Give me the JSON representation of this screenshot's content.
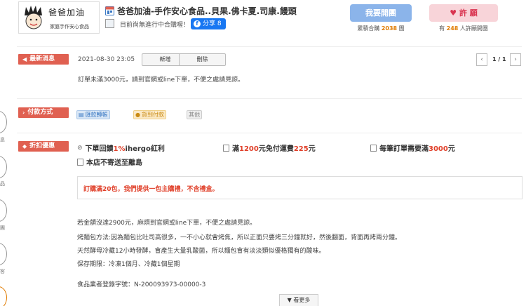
{
  "header": {
    "logo": {
      "title": "爸爸加油",
      "subtitle": "家庭手作安心食品"
    },
    "store_title": "爸爸加油-手作安心食品..貝果.佛卡夏.司康.饅頭",
    "store_status": "目前尚無進行中合購喔！",
    "share": {
      "label": "分享 8",
      "icon": "facebook-icon"
    },
    "open_group_button": "我要開團",
    "open_group_stat": {
      "prefix": "累積合購",
      "count": "2038",
      "suffix": "團"
    },
    "wish_button": "許 願",
    "wish_stat": {
      "prefix": "有",
      "count": "248",
      "suffix": "人許願開團"
    }
  },
  "sidenav": {
    "labels": [
      "息",
      "品",
      "團",
      "客"
    ]
  },
  "news": {
    "tag": "最新消息",
    "date": "2021-08-30 23:05",
    "add_button": "新增",
    "delete_button": "刪除",
    "pager": "1 / 1",
    "prev_icon": "chevron-left-icon",
    "next_icon": "chevron-right-icon",
    "text": "訂單未滿3000元，請到官網或line下單，不便之處請見諒。"
  },
  "payment": {
    "tag": "付款方式",
    "methods": [
      "匯款轉帳",
      "貨到付款",
      "其他"
    ]
  },
  "discount": {
    "tag": "折扣優惠",
    "items": [
      {
        "pre": "下單回饋",
        "hl": "1%",
        "post": "ihergo紅利"
      },
      {
        "pre": "滿",
        "hl": "1200",
        "mid": "元免付運費",
        "hl2": "225",
        "post": "元"
      },
      {
        "pre": "每筆訂單需要滿",
        "hl": "3000",
        "post": "元"
      }
    ],
    "no_island": "本店不寄送至離島",
    "notice": "訂購滿20包，我們提供一包主購禮，不含禮盒。"
  },
  "description": {
    "lines": [
      "若金額沒達2900元，麻煩到官網或line下單，不便之處請見諒。",
      "烤麵包方法:因為麵包比吐司高很多，一不小心就會烤焦，所以正面只要烤三分鐘就好，然後翻面，背面再烤兩分鐘。",
      "天然酵母冷藏12小時發酵，會產生大量乳酸菌，所以麵包會有淡淡類似優格獨有的酸味。",
      "保存期限：冷凍1個月、冷藏1個星期"
    ],
    "registration": "食品業者登錄字號：N-200093973-00000-3",
    "more_button": "▼ 看更多"
  },
  "colors": {
    "tag_red": "#e06051",
    "open_blue": "#8bb4ea",
    "wish_pink": "#f8d4d9",
    "highlight_red": "#e0402a",
    "count_orange": "#e07b00"
  }
}
